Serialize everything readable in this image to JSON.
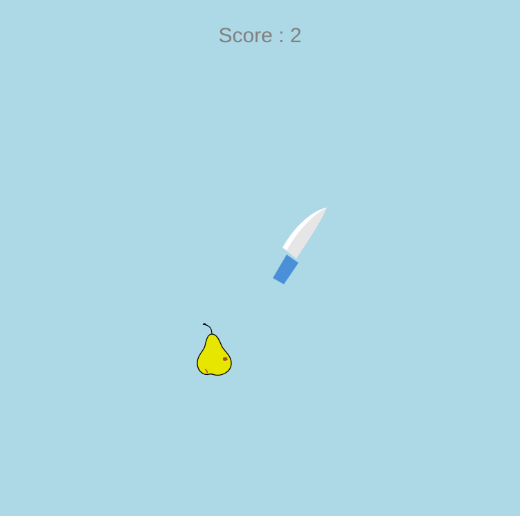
{
  "score": {
    "label": "Score",
    "separator": " : ",
    "value": 2
  },
  "knife": {
    "icon": "knife-icon",
    "blade_color": "#e8e8e8",
    "blade_highlight": "#ffffff",
    "handle_color": "#4a90d9"
  },
  "fruits": [
    {
      "kind": "pear",
      "icon": "pear-icon",
      "body_color": "#e6e600",
      "outline_color": "#000000",
      "spot_color": "#a0522d"
    }
  ],
  "colors": {
    "background": "#add8e6",
    "score_text": "#808080"
  }
}
